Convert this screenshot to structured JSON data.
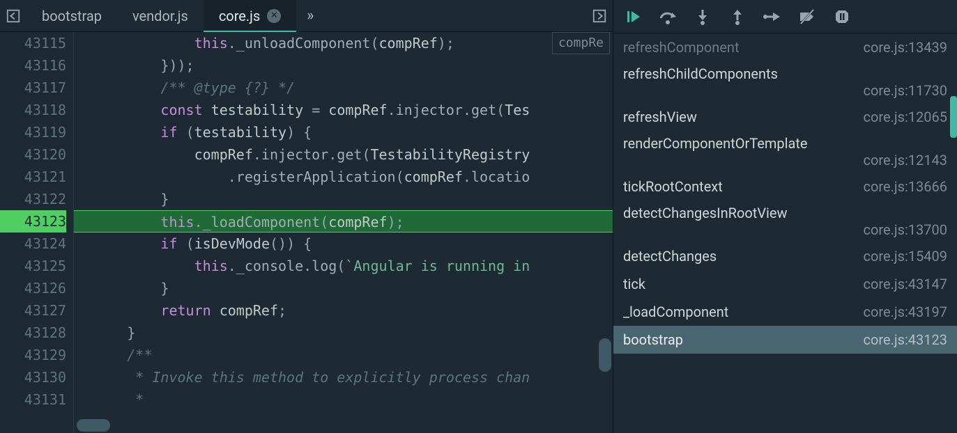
{
  "tabs": {
    "items": [
      {
        "label": "bootstrap",
        "active": false
      },
      {
        "label": "vendor.js",
        "active": false
      },
      {
        "label": "core.js",
        "active": true
      }
    ],
    "overflow_glyph": "»"
  },
  "editor": {
    "first_line": 43115,
    "exec_line": 43123,
    "inline_hint": "compRe",
    "lines": [
      {
        "indent": 14,
        "tokens": [
          [
            "this",
            "tk-this"
          ],
          [
            ".",
            "tk-punc"
          ],
          [
            "_unloadComponent",
            "tk-prop"
          ],
          [
            "(",
            "tk-punc"
          ],
          [
            "compRef",
            "tk-id"
          ],
          [
            ")",
            "tk-punc"
          ],
          [
            ";",
            "tk-punc"
          ]
        ]
      },
      {
        "indent": 10,
        "tokens": [
          [
            "}));",
            "tk-punc"
          ]
        ]
      },
      {
        "indent": 10,
        "tokens": [
          [
            "/** @type {?} */",
            "tk-comment"
          ]
        ]
      },
      {
        "indent": 10,
        "tokens": [
          [
            "const",
            "tk-kw"
          ],
          [
            " ",
            "tk-punc"
          ],
          [
            "testability",
            "tk-id"
          ],
          [
            " ",
            "tk-punc"
          ],
          [
            "=",
            "tk-punc"
          ],
          [
            " ",
            "tk-punc"
          ],
          [
            "compRef",
            "tk-id"
          ],
          [
            ".",
            "tk-punc"
          ],
          [
            "injector",
            "tk-prop"
          ],
          [
            ".",
            "tk-punc"
          ],
          [
            "get",
            "tk-prop"
          ],
          [
            "(",
            "tk-punc"
          ],
          [
            "Tes",
            "tk-id"
          ]
        ]
      },
      {
        "indent": 10,
        "tokens": [
          [
            "if",
            "tk-kw"
          ],
          [
            " ",
            "tk-punc"
          ],
          [
            "(",
            "tk-punc"
          ],
          [
            "testability",
            "tk-id"
          ],
          [
            ")",
            "tk-punc"
          ],
          [
            " ",
            "tk-punc"
          ],
          [
            "{",
            "tk-punc"
          ]
        ]
      },
      {
        "indent": 14,
        "tokens": [
          [
            "compRef",
            "tk-id"
          ],
          [
            ".",
            "tk-punc"
          ],
          [
            "injector",
            "tk-prop"
          ],
          [
            ".",
            "tk-punc"
          ],
          [
            "get",
            "tk-prop"
          ],
          [
            "(",
            "tk-punc"
          ],
          [
            "TestabilityRegistry",
            "tk-id"
          ]
        ]
      },
      {
        "indent": 18,
        "tokens": [
          [
            ".",
            "tk-punc"
          ],
          [
            "registerApplication",
            "tk-prop"
          ],
          [
            "(",
            "tk-punc"
          ],
          [
            "compRef",
            "tk-id"
          ],
          [
            ".",
            "tk-punc"
          ],
          [
            "locatio",
            "tk-prop"
          ]
        ]
      },
      {
        "indent": 10,
        "tokens": [
          [
            "}",
            "tk-punc"
          ]
        ]
      },
      {
        "indent": 10,
        "tokens": [
          [
            "this",
            "tk-this"
          ],
          [
            ".",
            "tk-punc"
          ],
          [
            "_loadComponent",
            "tk-prop"
          ],
          [
            "(",
            "tk-punc"
          ],
          [
            "compRef",
            "tk-id"
          ],
          [
            ")",
            "tk-punc"
          ],
          [
            ";",
            "tk-punc"
          ]
        ]
      },
      {
        "indent": 10,
        "tokens": [
          [
            "if",
            "tk-kw"
          ],
          [
            " ",
            "tk-punc"
          ],
          [
            "(",
            "tk-punc"
          ],
          [
            "isDevMode",
            "tk-id"
          ],
          [
            "()",
            "tk-punc"
          ],
          [
            ")",
            "tk-punc"
          ],
          [
            " ",
            "tk-punc"
          ],
          [
            "{",
            "tk-punc"
          ]
        ]
      },
      {
        "indent": 14,
        "tokens": [
          [
            "this",
            "tk-this"
          ],
          [
            ".",
            "tk-punc"
          ],
          [
            "_console",
            "tk-prop"
          ],
          [
            ".",
            "tk-punc"
          ],
          [
            "log",
            "tk-prop"
          ],
          [
            "(",
            "tk-punc"
          ],
          [
            "`Angular is running in",
            "tk-str"
          ]
        ]
      },
      {
        "indent": 10,
        "tokens": [
          [
            "}",
            "tk-punc"
          ]
        ]
      },
      {
        "indent": 10,
        "tokens": [
          [
            "return",
            "tk-kw"
          ],
          [
            " ",
            "tk-punc"
          ],
          [
            "compRef",
            "tk-id"
          ],
          [
            ";",
            "tk-punc"
          ]
        ]
      },
      {
        "indent": 6,
        "tokens": [
          [
            "}",
            "tk-punc"
          ]
        ]
      },
      {
        "indent": 6,
        "tokens": [
          [
            "/**",
            "tk-comment"
          ]
        ]
      },
      {
        "indent": 7,
        "tokens": [
          [
            "* Invoke this method to explicitly process chan",
            "tk-comment"
          ]
        ]
      },
      {
        "indent": 7,
        "tokens": [
          [
            "*",
            "tk-comment"
          ]
        ]
      }
    ]
  },
  "debugger": {
    "buttons": [
      "resume",
      "step-over",
      "step-into",
      "step-out",
      "step",
      "deactivate-breakpoints",
      "pause"
    ]
  },
  "callstack": {
    "frames": [
      {
        "name": "refreshComponent",
        "loc": "core.js:13439",
        "faded": true,
        "wrap": false
      },
      {
        "name": "refreshChildComponents",
        "loc": "core.js:11730",
        "wrap": true
      },
      {
        "name": "refreshView",
        "loc": "core.js:12065",
        "wrap": false
      },
      {
        "name": "renderComponentOrTemplate",
        "loc": "core.js:12143",
        "wrap": true
      },
      {
        "name": "tickRootContext",
        "loc": "core.js:13666",
        "wrap": false
      },
      {
        "name": "detectChangesInRootView",
        "loc": "core.js:13700",
        "wrap": true
      },
      {
        "name": "detectChanges",
        "loc": "core.js:15409",
        "wrap": false
      },
      {
        "name": "tick",
        "loc": "core.js:43147",
        "wrap": false
      },
      {
        "name": "_loadComponent",
        "loc": "core.js:43197",
        "wrap": false
      },
      {
        "name": "bootstrap",
        "loc": "core.js:43123",
        "wrap": false,
        "selected": true
      }
    ]
  }
}
